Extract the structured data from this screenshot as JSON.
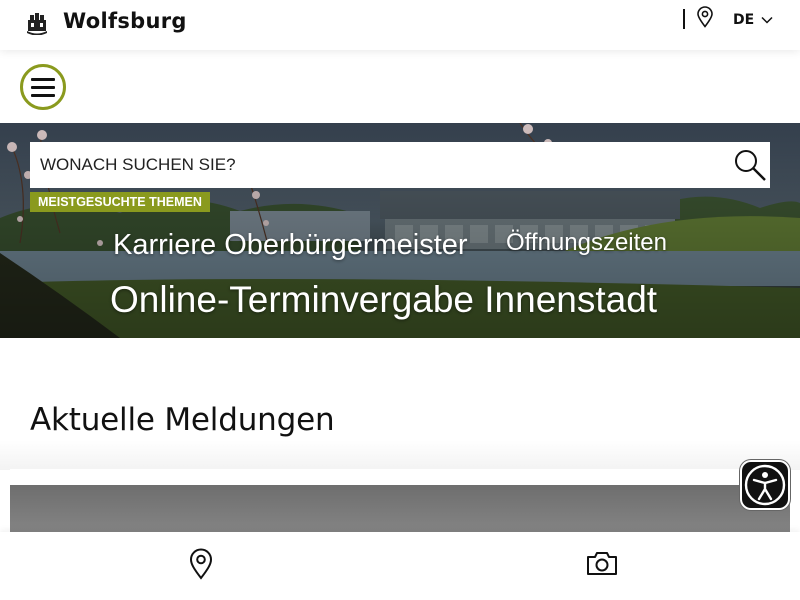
{
  "header": {
    "brand": "Wolfsburg",
    "language": "DE",
    "crest_icon": "city-crest-icon",
    "location_icon": "map-pin-icon",
    "language_icon": "chevron-down-icon"
  },
  "menu": {
    "icon": "hamburger-icon",
    "accent_color": "#8a9a1e"
  },
  "hero": {
    "search_placeholder": "WONACH SUCHEN SIE?",
    "search_icon": "search-icon",
    "popular_label": "MEISTGESUCHTE THEMEN",
    "topics": [
      "Karriere Oberbürgermeister",
      "Öffnungszeiten",
      "Online-Terminvergabe Innenstadt"
    ]
  },
  "main": {
    "section_title": "Aktuelle Meldungen"
  },
  "accessibility": {
    "icon": "accessibility-person-icon"
  },
  "bottom_nav": {
    "items": [
      {
        "icon": "map-pin-icon"
      },
      {
        "icon": "camera-icon"
      }
    ]
  },
  "colors": {
    "accent": "#8a9a1e",
    "text": "#111111",
    "background": "#ffffff"
  }
}
